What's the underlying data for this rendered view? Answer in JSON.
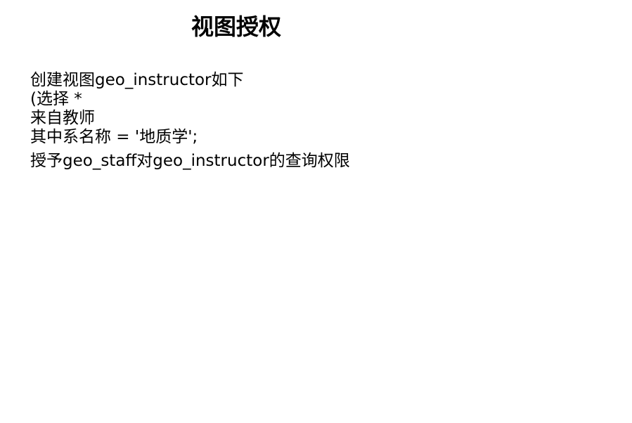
{
  "title": "视图授权",
  "code_lines": [
    "创建视图geo_instructor如下",
    "(选择 *",
    "来自教师",
    "其中系名称 = '地质学';"
  ],
  "grant_line": "授予geo_staff对geo_instructor的查询权限"
}
